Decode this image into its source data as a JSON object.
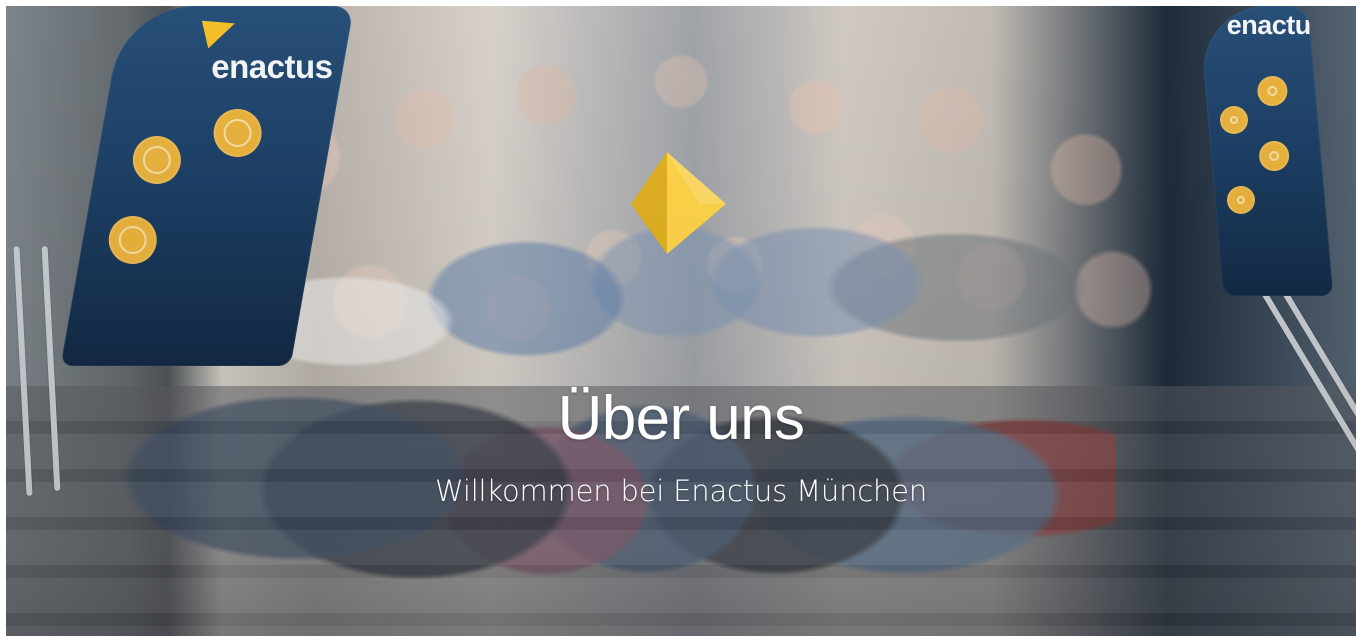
{
  "hero": {
    "title": "Über uns",
    "subtitle": "Willkommen bei Enactus München"
  },
  "banners": {
    "left_logo": "enactus",
    "right_logo": "enactus"
  },
  "icons": {
    "center_logo": "enactus-logo-icon",
    "banner_mark": "enactus-mark-icon"
  },
  "colors": {
    "accent": "#F4BF28",
    "banner_blue": "#274F78",
    "text": "#FFFFFF"
  }
}
